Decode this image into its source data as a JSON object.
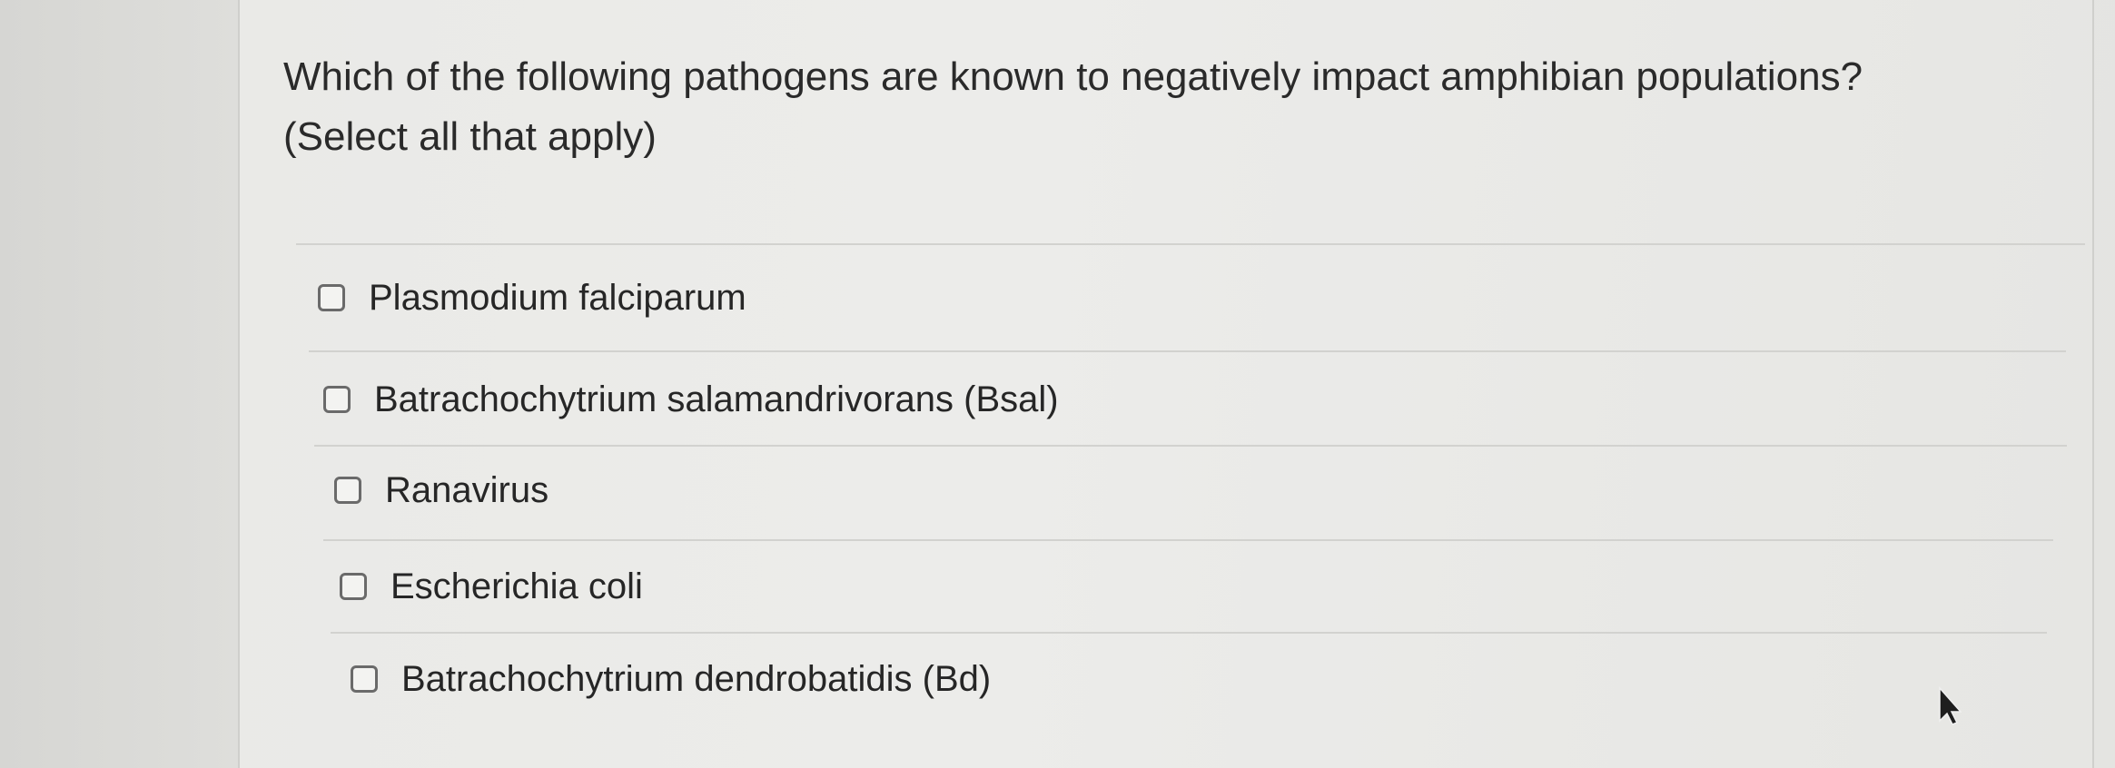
{
  "question": {
    "line1": "Which of the following pathogens are known to negatively impact amphibian populations?",
    "line2": "(Select all that apply)"
  },
  "options": [
    {
      "label": "Plasmodium falciparum",
      "checked": false
    },
    {
      "label": "Batrachochytrium salamandrivorans (Bsal)",
      "checked": false
    },
    {
      "label": "Ranavirus",
      "checked": false
    },
    {
      "label": "Escherichia coli",
      "checked": false
    },
    {
      "label": "Batrachochytrium dendrobatidis (Bd)",
      "checked": false
    }
  ],
  "icons": {
    "cursor": "mouse-pointer-icon",
    "checkbox": "checkbox-icon"
  },
  "colors": {
    "text": "#2a2a2a",
    "checkbox_border": "#6a6a6a",
    "background": "#eaeae7"
  }
}
